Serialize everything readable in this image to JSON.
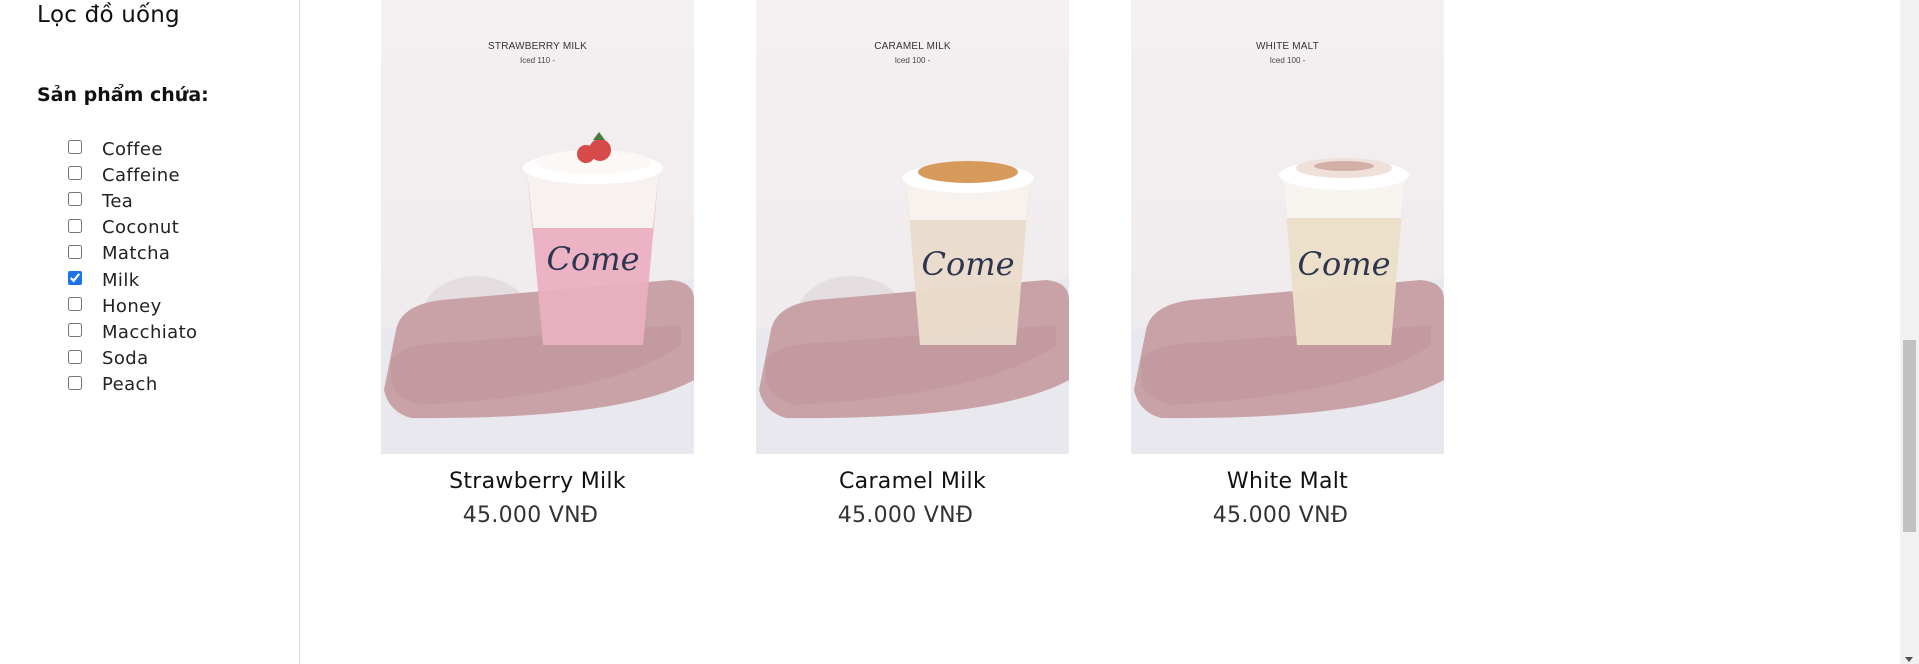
{
  "sidebar": {
    "title": "Lọc đồ uống",
    "subtitle": "Sản phẩm chứa:",
    "filters": [
      {
        "label": "Coffee",
        "checked": false
      },
      {
        "label": "Caffeine",
        "checked": false
      },
      {
        "label": "Tea",
        "checked": false
      },
      {
        "label": "Coconut",
        "checked": false
      },
      {
        "label": "Matcha",
        "checked": false
      },
      {
        "label": "Milk",
        "checked": true
      },
      {
        "label": "Honey",
        "checked": false
      },
      {
        "label": "Macchiato",
        "checked": false
      },
      {
        "label": "Soda",
        "checked": false
      },
      {
        "label": "Peach",
        "checked": false
      }
    ]
  },
  "products": [
    {
      "name": "Strawberry Milk",
      "price": "45.000 VNĐ",
      "image_menu_name": "STRAWBERRY MILK",
      "image_menu_price": "Iced 110 -",
      "drink_color": "#eab0c0",
      "topping_color": "#d64a4a",
      "cup_logo": "Come"
    },
    {
      "name": "Caramel Milk",
      "price": "45.000 VNĐ",
      "image_menu_name": "CARAMEL MILK",
      "image_menu_price": "Iced 100 -",
      "drink_color": "#e9dccb",
      "topping_color": "#d69a5a",
      "cup_logo": "Come"
    },
    {
      "name": "White Malt",
      "price": "45.000 VNĐ",
      "image_menu_name": "WHITE MALT",
      "image_menu_price": "Iced 100 -",
      "drink_color": "#ecdfc8",
      "topping_color": "#c99a90",
      "cup_logo": "Come"
    }
  ],
  "colors": {
    "tray": "#c9a2a7",
    "tray_edge": "#b88f95",
    "checkbox_accent": "#1a73e8"
  }
}
